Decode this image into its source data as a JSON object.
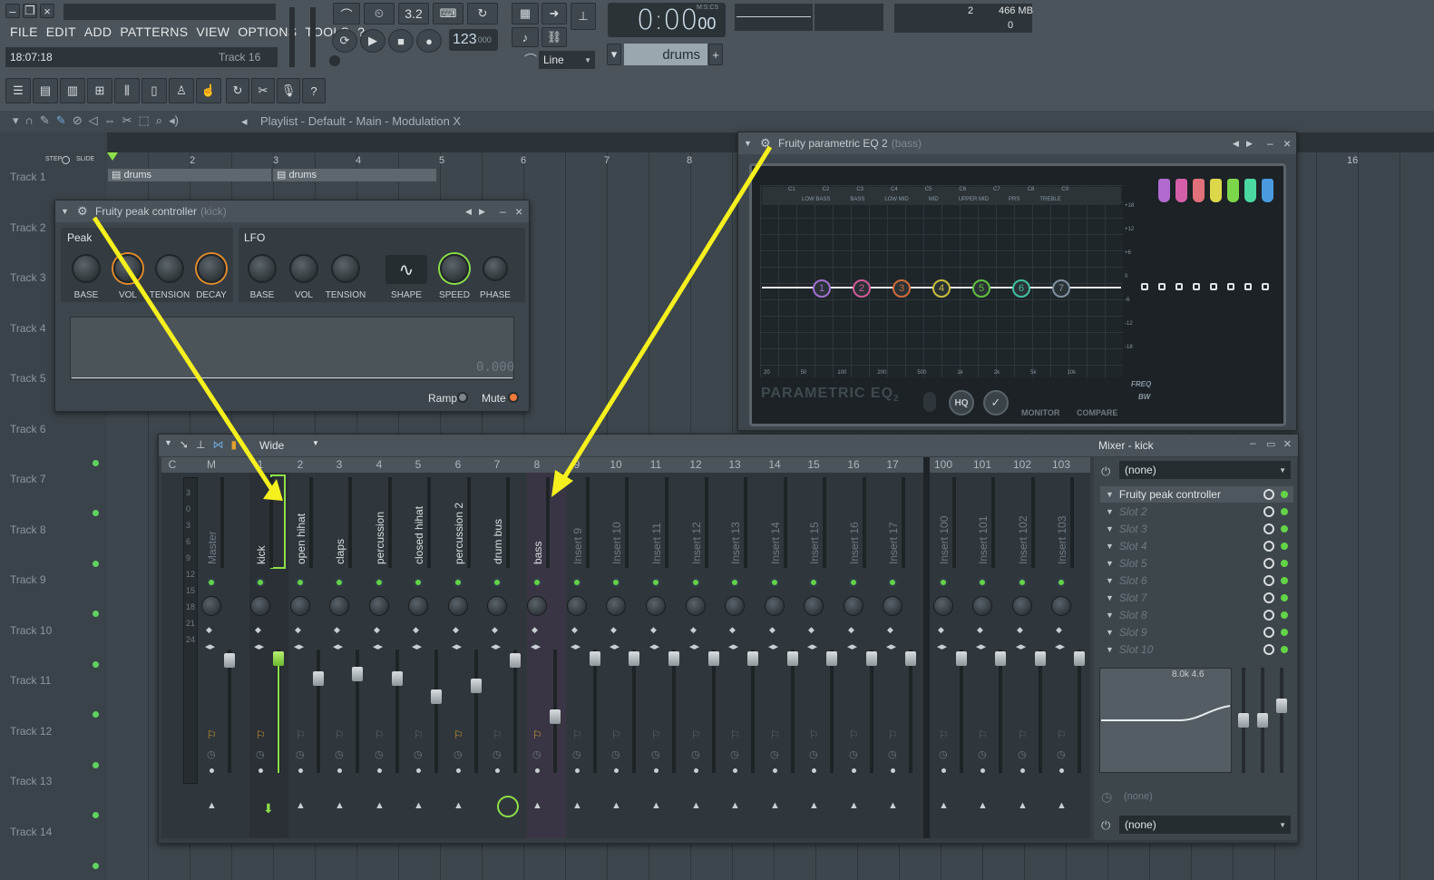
{
  "menu": [
    "FILE",
    "EDIT",
    "ADD",
    "PATTERNS",
    "VIEW",
    "OPTIONS",
    "TOOLS",
    "?"
  ],
  "clock": "18:07:18",
  "hint_track": "Track 16",
  "transport": {
    "time": "0:00",
    "time_frac": "00",
    "time_unit": "M:S:CS",
    "tempo": "123",
    "tempo_frac": "000",
    "pattern_mode_value": "3.2"
  },
  "cpu": {
    "value": "2",
    "memory": "466 MB",
    "polyphony": "0"
  },
  "snap": "Line",
  "pattern": "drums",
  "playlist": {
    "title": "Playlist - Default - Main - Modulation X",
    "step_label": "STEP",
    "slide_label": "SLIDE",
    "ruler": [
      "2",
      "3",
      "4",
      "5",
      "6",
      "7",
      "8",
      "16"
    ],
    "tracks": [
      "Track 1",
      "Track 2",
      "Track 3",
      "Track 4",
      "Track 5",
      "Track 6",
      "Track 7",
      "Track 8",
      "Track 9",
      "Track 10",
      "Track 11",
      "Track 12",
      "Track 13",
      "Track 14"
    ],
    "clips": [
      "drums",
      "drums"
    ]
  },
  "peak": {
    "title": "Fruity peak controller",
    "sub": "(kick)",
    "peak_group": "Peak",
    "lfo_group": "LFO",
    "peak_knobs": [
      "BASE",
      "VOL",
      "TENSION",
      "DECAY"
    ],
    "lfo_knobs": [
      "BASE",
      "VOL",
      "TENSION",
      "SHAPE",
      "SPEED",
      "PHASE"
    ],
    "readout": "0.000",
    "ramp": "Ramp",
    "mute": "Mute"
  },
  "eq": {
    "title": "Fruity parametric EQ 2",
    "sub": "(bass)",
    "logo": "PARAMETRIC EQ",
    "logo_num": "2",
    "notes": [
      "C1",
      "C2",
      "C3",
      "C4",
      "C5",
      "C6",
      "C7",
      "C8",
      "C9"
    ],
    "bands_text": [
      "LOW BASS",
      "BASS",
      "LOW MID",
      "MID",
      "UPPER MID",
      "PRS",
      "TREBLE"
    ],
    "freqs": [
      "20",
      "50",
      "100",
      "200",
      "500",
      "1k",
      "2k",
      "5k",
      "10k"
    ],
    "db": [
      "+18",
      "+12",
      "+6",
      "0",
      "-6",
      "-12",
      "-18"
    ],
    "band_nums": [
      "1",
      "2",
      "3",
      "4",
      "5",
      "6",
      "7"
    ],
    "freq_label": "FREQ",
    "bw_label": "BW",
    "hq": "HQ",
    "monitor": "MONITOR",
    "compare": "COMPARE"
  },
  "mixer": {
    "view": "Wide",
    "head": [
      "C",
      "M",
      "1",
      "2",
      "3",
      "4",
      "5",
      "6",
      "7",
      "8",
      "9",
      "10",
      "11",
      "12",
      "13",
      "14",
      "15",
      "16",
      "17",
      "100",
      "101",
      "102",
      "103"
    ],
    "channels": [
      "Master",
      "kick",
      "open hihat",
      "claps",
      "percussion",
      "closed hihat",
      "percussion 2",
      "drum bus",
      "bass",
      "Insert 9",
      "Insert 10",
      "Insert 11",
      "Insert 12",
      "Insert 13",
      "Insert 14",
      "Insert 15",
      "Insert 16",
      "Insert 17",
      "Insert 100",
      "Insert 101",
      "Insert 102",
      "Insert 103"
    ],
    "meter_scale": [
      "3",
      "0",
      "3",
      "6",
      "9",
      "12",
      "15",
      "18",
      "21",
      "24"
    ]
  },
  "mixer_panel": {
    "title": "Mixer - kick",
    "input": "(none)",
    "slots": [
      "Fruity peak controller",
      "Slot 2",
      "Slot 3",
      "Slot 4",
      "Slot 5",
      "Slot 6",
      "Slot 7",
      "Slot 8",
      "Slot 9",
      "Slot 10"
    ],
    "eq_readout": "8.0k 4.6",
    "send_none": "(none)",
    "output": "(none)"
  },
  "colors": {
    "accent_green": "#63d447",
    "annotation_yellow": "#f5f01e",
    "knob_orange": "#e38b2c"
  }
}
